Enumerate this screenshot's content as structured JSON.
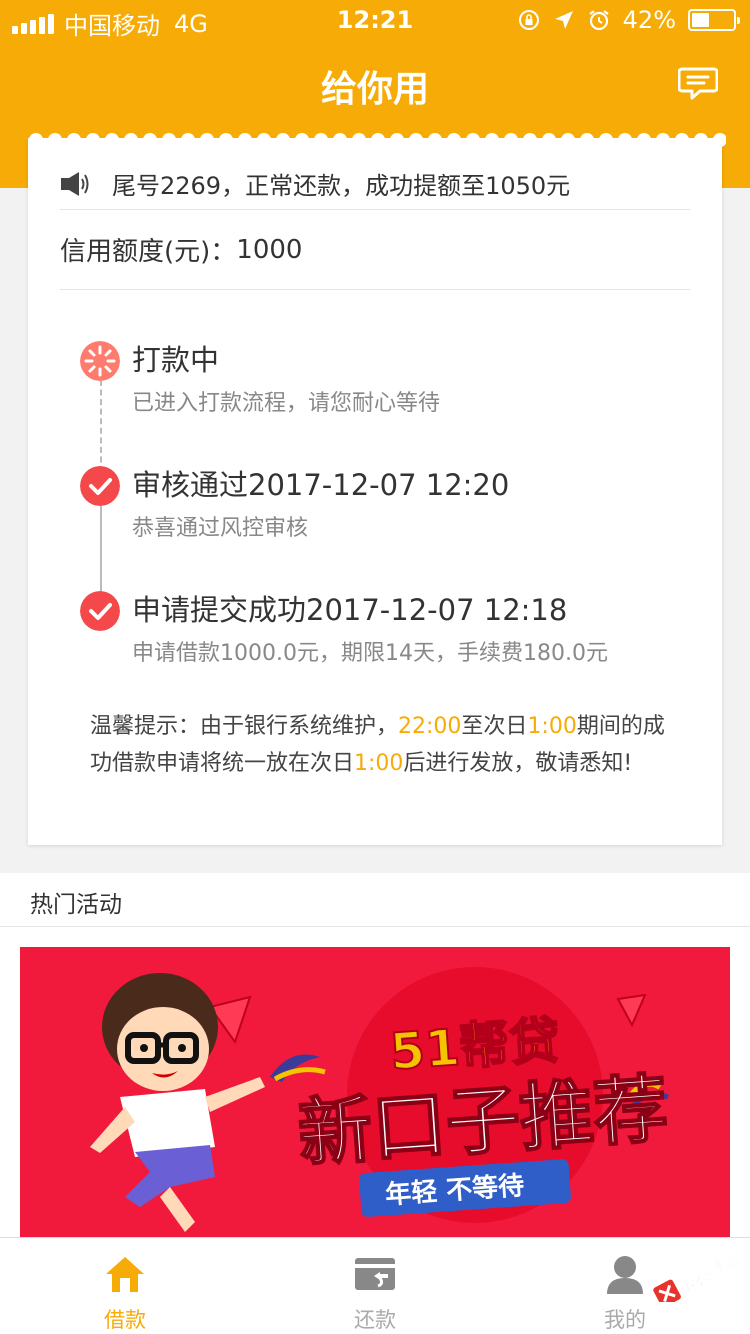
{
  "status": {
    "carrier": "中国移动",
    "network": "4G",
    "time": "12:21",
    "battery": "42%",
    "battery_level": 0.42
  },
  "header": {
    "title": "给你用",
    "message_icon": "chat-bubble-icon"
  },
  "card": {
    "notice": "尾号2269，正常还款，成功提额至1050元",
    "credit_label": "信用额度(元)：",
    "credit_value": "1000",
    "steps": [
      {
        "title": "打款中",
        "desc": "已进入打款流程，请您耐心等待",
        "state": "processing"
      },
      {
        "title": "审核通过2017-12-07 12:20",
        "desc": "恭喜通过风控审核",
        "state": "done"
      },
      {
        "title": "申请提交成功2017-12-07 12:18",
        "desc": "申请借款1000.0元，期限14天，手续费180.0元",
        "state": "done"
      }
    ],
    "tip": {
      "p1": "温馨提示：由于银行系统维护，",
      "t1": "22:00",
      "p2": "至次日",
      "t2": "1:00",
      "p3": "期间的成功借款申请将统一放在次日",
      "t3": "1:00",
      "p4": "后进行发放，敬请悉知!"
    }
  },
  "hot": {
    "title": "热门活动",
    "banner": {
      "brand": "51帮贷",
      "headline": "新口子推荐",
      "slogan": "年轻 不等待"
    }
  },
  "tabs": [
    {
      "label": "借款",
      "icon": "home-icon",
      "active": true
    },
    {
      "label": "还款",
      "icon": "repay-card-icon",
      "active": false
    },
    {
      "label": "我的",
      "icon": "user-icon",
      "active": false
    }
  ],
  "watermark": "卡农社区",
  "colors": {
    "brand": "#f7ab06",
    "processing": "#ff7b6e",
    "done": "#f4484a",
    "banner": "#f21a3c"
  }
}
